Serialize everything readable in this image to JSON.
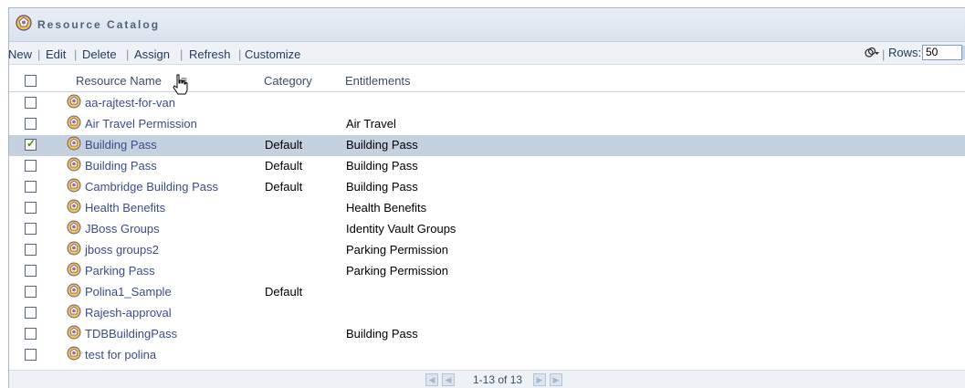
{
  "panel": {
    "title": "Resource Catalog",
    "title_icon": "resource-catalog-icon"
  },
  "toolbar": {
    "new_label": "New",
    "edit_label": "Edit",
    "delete_label": "Delete",
    "assign_label": "Assign",
    "refresh_label": "Refresh",
    "customize_label": "Customize",
    "rows_label": "Rows:",
    "rows_value": "50",
    "separator": "|"
  },
  "table": {
    "headers": {
      "name": "Resource Name",
      "category": "Category",
      "entitlements": "Entitlements"
    },
    "rows": [
      {
        "name": "aa-rajtest-for-van",
        "category": "",
        "entitlements": "",
        "checked": false
      },
      {
        "name": "Air Travel Permission",
        "category": "",
        "entitlements": "Air Travel",
        "checked": false
      },
      {
        "name": "Building Pass",
        "category": "Default",
        "entitlements": "Building Pass",
        "checked": true
      },
      {
        "name": "Building Pass",
        "category": "Default",
        "entitlements": "Building Pass",
        "checked": false
      },
      {
        "name": "Cambridge Building Pass",
        "category": "Default",
        "entitlements": "Building Pass",
        "checked": false
      },
      {
        "name": "Health Benefits",
        "category": "",
        "entitlements": "Health Benefits",
        "checked": false
      },
      {
        "name": "JBoss Groups",
        "category": "",
        "entitlements": "Identity Vault Groups",
        "checked": false
      },
      {
        "name": "jboss groups2",
        "category": "",
        "entitlements": "Parking Permission",
        "checked": false
      },
      {
        "name": "Parking Pass",
        "category": "",
        "entitlements": "Parking Permission",
        "checked": false
      },
      {
        "name": "Polina1_Sample",
        "category": "Default",
        "entitlements": "",
        "checked": false
      },
      {
        "name": "Rajesh-approval",
        "category": "",
        "entitlements": "",
        "checked": false
      },
      {
        "name": "TDBBuildingPass",
        "category": "",
        "entitlements": "Building Pass",
        "checked": false
      },
      {
        "name": "test for polina",
        "category": "",
        "entitlements": "",
        "checked": false
      }
    ]
  },
  "pager": {
    "range_text": "1-13 of 13"
  },
  "colors": {
    "selected_row": "#c5d1df",
    "link_text": "#3b4d88",
    "title_text": "#51637a"
  }
}
